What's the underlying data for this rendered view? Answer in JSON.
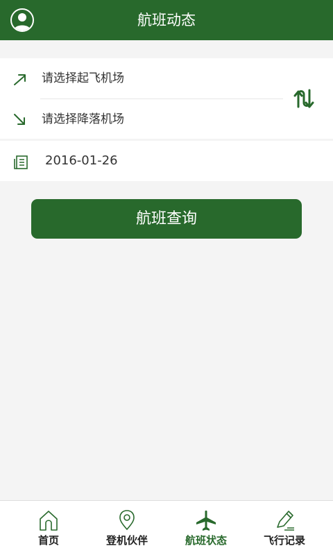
{
  "header": {
    "title": "航班动态",
    "avatar_icon": "user-avatar-icon"
  },
  "route": {
    "departure_placeholder": "请选择起飞机场",
    "arrival_placeholder": "请选择降落机场",
    "departure_icon": "takeoff-arrow-icon",
    "arrival_icon": "landing-arrow-icon",
    "swap_icon": "swap-icon"
  },
  "date": {
    "value": "2016-01-26",
    "icon": "calendar-icon"
  },
  "query_button": {
    "label": "航班查询"
  },
  "tabbar": {
    "tabs": [
      {
        "label": "首页",
        "icon": "home-icon",
        "active": false
      },
      {
        "label": "登机伙伴",
        "icon": "location-pin-icon",
        "active": false
      },
      {
        "label": "航班状态",
        "icon": "airplane-icon",
        "active": true
      },
      {
        "label": "飞行记录",
        "icon": "pencil-icon",
        "active": false
      }
    ]
  },
  "colors": {
    "brand": "#28692c",
    "background": "#f4f4f4",
    "card": "#ffffff",
    "text": "#333333"
  }
}
